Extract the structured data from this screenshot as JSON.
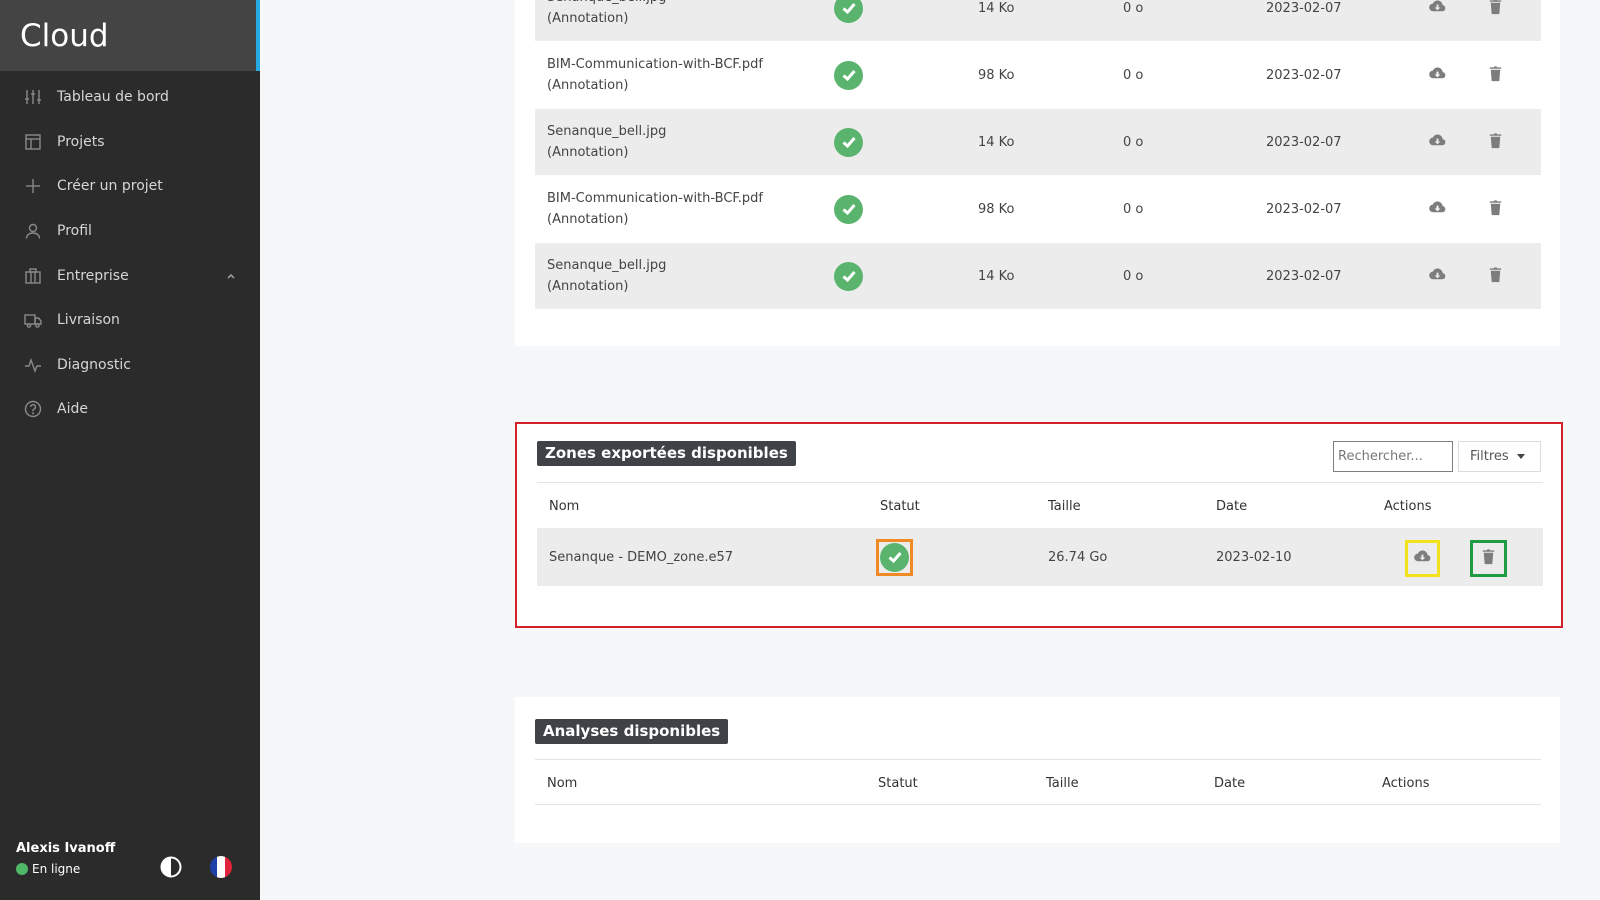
{
  "app": {
    "title": "Cloud"
  },
  "sidebar": {
    "items": [
      {
        "label": "Tableau de bord",
        "icon": "sliders-icon"
      },
      {
        "label": "Projets",
        "icon": "layout-icon"
      },
      {
        "label": "Créer un projet",
        "icon": "plus-icon"
      },
      {
        "label": "Profil",
        "icon": "user-icon"
      },
      {
        "label": "Entreprise",
        "icon": "building-icon",
        "expanded": true
      },
      {
        "label": "Livraison",
        "icon": "truck-icon"
      },
      {
        "label": "Diagnostic",
        "icon": "pulse-icon"
      },
      {
        "label": "Aide",
        "icon": "help-icon"
      }
    ],
    "user": {
      "name": "Alexis Ivanoff",
      "status": "En ligne",
      "status_color": "#4fb868"
    }
  },
  "top_list": {
    "rows": [
      {
        "name": "Senanque_bell.jpg",
        "type": "(Annotation)",
        "size": "14 Ko",
        "size2": "0 o",
        "date": "2023-02-07"
      },
      {
        "name": "BIM-Communication-with-BCF.pdf",
        "type": "(Annotation)",
        "size": "98 Ko",
        "size2": "0 o",
        "date": "2023-02-07"
      },
      {
        "name": "Senanque_bell.jpg",
        "type": "(Annotation)",
        "size": "14 Ko",
        "size2": "0 o",
        "date": "2023-02-07"
      },
      {
        "name": "BIM-Communication-with-BCF.pdf",
        "type": "(Annotation)",
        "size": "98 Ko",
        "size2": "0 o",
        "date": "2023-02-07"
      },
      {
        "name": "Senanque_bell.jpg",
        "type": "(Annotation)",
        "size": "14 Ko",
        "size2": "0 o",
        "date": "2023-02-07"
      }
    ]
  },
  "zones": {
    "title": "Zones exportées disponibles",
    "search_placeholder": "Rechercher...",
    "filters_label": "Filtres",
    "columns": {
      "name": "Nom",
      "status": "Statut",
      "size": "Taille",
      "date": "Date",
      "actions": "Actions"
    },
    "rows": [
      {
        "name": "Senanque - DEMO_zone.e57",
        "size": "26.74 Go",
        "date": "2023-02-10"
      }
    ]
  },
  "analyses": {
    "title": "Analyses disponibles",
    "columns": {
      "name": "Nom",
      "status": "Statut",
      "size": "Taille",
      "date": "Date",
      "actions": "Actions"
    }
  },
  "colors": {
    "accent": "#27a9e1",
    "success": "#5ab46e",
    "highlight_red": "#d3212c",
    "highlight_orange": "#f08a24",
    "highlight_yellow": "#f2e21b",
    "highlight_green": "#1f9c44"
  }
}
